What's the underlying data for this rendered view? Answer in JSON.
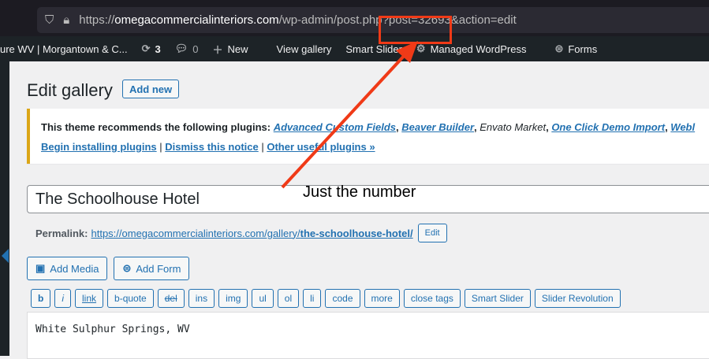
{
  "browser": {
    "url_prefix": "https://",
    "url_host": "omegacommercialinteriors.com",
    "url_path": "/wp-admin/post.php?post=32693&action=edit"
  },
  "adminbar": {
    "site": "ure WV | Morgantown & C...",
    "updates": "3",
    "comments": "0",
    "new": "New",
    "view": "View gallery",
    "smart_slider": "Smart Slider",
    "managed": "Managed WordPress",
    "forms": "Forms"
  },
  "page": {
    "title": "Edit gallery",
    "add_new": "Add new"
  },
  "notice": {
    "text": "This theme recommends the following plugins:",
    "plugins": [
      "Advanced Custom Fields",
      "Beaver Builder",
      "Envato Market",
      "One Click Demo Import",
      "Webl"
    ],
    "actions": [
      "Begin installing plugins",
      "Dismiss this notice",
      "Other useful plugins »"
    ]
  },
  "post": {
    "title": "The Schoolhouse Hotel",
    "permalink_label": "Permalink:",
    "permalink_base": "https://omegacommercialinteriors.com/gallery/",
    "permalink_slug": "the-schoolhouse-hotel/",
    "edit": "Edit"
  },
  "media": {
    "add_media": "Add Media",
    "add_form": "Add Form"
  },
  "quicktags": [
    "b",
    "i",
    "link",
    "b-quote",
    "del",
    "ins",
    "img",
    "ul",
    "ol",
    "li",
    "code",
    "more",
    "close tags",
    "Smart Slider",
    "Slider Revolution"
  ],
  "content": "White Sulphur Springs, WV",
  "annotation": {
    "text": "Just the number",
    "color": "#f03a17"
  }
}
